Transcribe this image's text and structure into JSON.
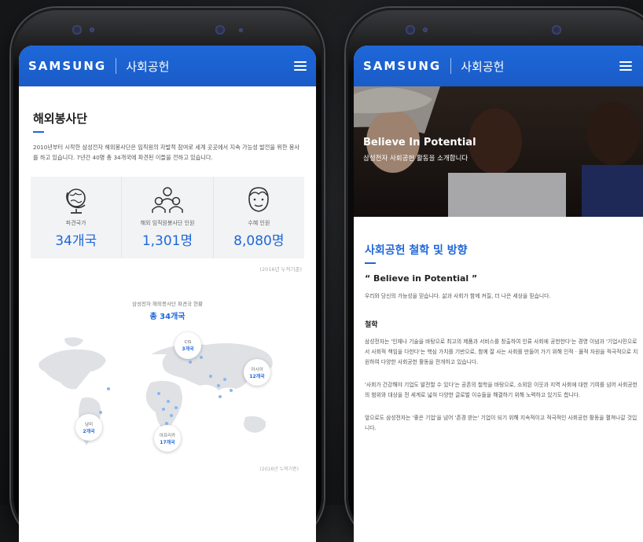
{
  "common": {
    "brand": "SAMSUNG",
    "section": "사회공헌"
  },
  "left": {
    "title": "해외봉사단",
    "intro": "2010년부터 시작한 삼성전자 해외봉사단은 임직원의 자발적 참여로 세계 곳곳에서 지속 가능성 발전을 위한 봉사를 하고 있습니다. 7년간 40명 총 34개국에 파견된 이들을 전하고 있습니다.",
    "stats": [
      {
        "icon": "globe-icon",
        "label": "파견국가",
        "value": "34개국"
      },
      {
        "icon": "volunteers-icon",
        "label": "해외 임직원봉사단 인원",
        "value": "1,301명"
      },
      {
        "icon": "beneficiary-icon",
        "label": "수혜 인원",
        "value": "8,080명"
      }
    ],
    "stats_note": "(2016년 누적기준)",
    "map": {
      "subtitle": "삼성전자 해외봉사단 파견국 현황",
      "total": "총 34개국",
      "regions": [
        {
          "name": "CIS",
          "count": "3개국"
        },
        {
          "name": "아시아",
          "count": "12개국"
        },
        {
          "name": "남미",
          "count": "2개국"
        },
        {
          "name": "아프리카",
          "count": "17개국"
        }
      ],
      "note": "(2016년 누적기준)"
    }
  },
  "right": {
    "hero_title": "Believe In Potential",
    "hero_subtitle": "삼성전자 사회공헌 활동을 소개합니다",
    "title": "사회공헌 철학 및 방향",
    "quote": "“ Believe in Potential ”",
    "quote_desc": "우리와 당신의 가능성을 믿습니다. 삶과 사회가 함께 커질, 더 나은 세상을 믿습니다.",
    "heading": "철학",
    "paragraphs": [
      "삼성전자는 '인재나 기술을 바탕으로 최고의 제품과 서비스를 창출하여 인류 사회에 공헌한다'는 경영 이념과 '기업시민으로서 사회적 책임을 다한다'는 핵심 가치를 기반으로, 함께 잘 사는 사회를 만들어 가기 위해 인적 · 물적 자원을 적극적으로 지원하여 다양한 사회공헌 활동을 전개하고 있습니다.",
      "'사회가 건강해야 기업도 발전할 수 있다'는 공존의 철학을 바탕으로, 소외된 이웃과 지역 사회에 대한 기여를 넘어 사회공헌의 범위와 대상을 전 세계로 넓혀 다양한 글로벌 이슈들을 해결하기 위해 노력하고 있기도 합니다.",
      "앞으로도 삼성전자는 '좋은 기업'을 넘어 '존경 받는' 기업이 되기 위해 지속적이고 적극적인 사회공헌 활동을 펼쳐나갈 것입니다."
    ]
  },
  "colors": {
    "accent": "#1e67d8",
    "bg": "#1a1b1d"
  }
}
